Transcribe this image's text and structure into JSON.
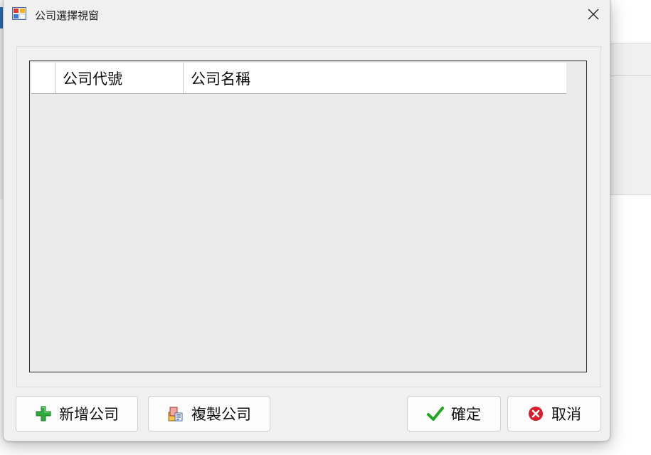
{
  "window": {
    "title": "公司選擇視窗"
  },
  "grid": {
    "columns": [
      {
        "label": "公司代號"
      },
      {
        "label": "公司名稱"
      }
    ],
    "rows": []
  },
  "buttons": {
    "add_company": "新增公司",
    "copy_company": "複製公司",
    "ok": "確定",
    "cancel": "取消"
  },
  "icons": {
    "app": "app-window-icon",
    "close": "close-icon",
    "add": "plus-icon",
    "copy": "copy-icon",
    "ok": "checkmark-icon",
    "cancel": "cancel-circle-icon"
  },
  "colors": {
    "plus_green": "#2eaa3a",
    "check_green": "#1fa81f",
    "cancel_red": "#d81e2a"
  }
}
